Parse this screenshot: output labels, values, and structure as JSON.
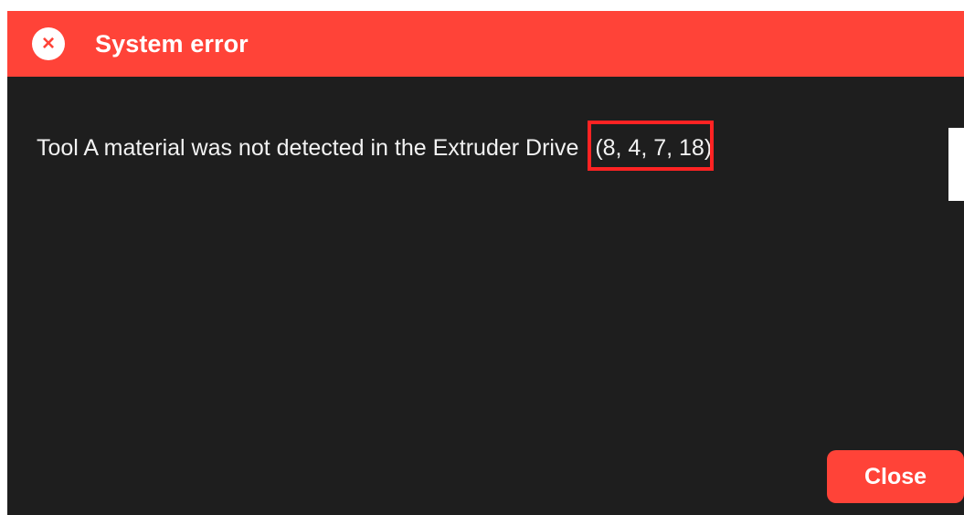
{
  "dialog": {
    "title": "System error",
    "close_icon": "close-icon",
    "message_prefix": "Tool A material was not detected in the Extruder Drive",
    "error_code": "(8, 4, 7, 18)",
    "close_button_label": "Close",
    "accent_color": "#ff4338"
  }
}
